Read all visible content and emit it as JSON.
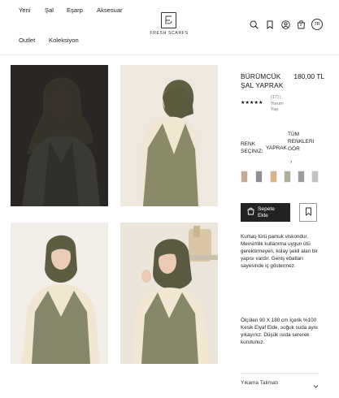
{
  "header": {
    "nav_row1": [
      "Yeni",
      "Şal",
      "Eşarp",
      "Aksesuar"
    ],
    "nav_row2": [
      "Outlet",
      "Koleksiyon"
    ],
    "logo_text": "FRESH SCARFS",
    "lang": "TR",
    "cart_count": "0",
    "icons": [
      "search-icon",
      "bookmark-icon",
      "user-icon",
      "bag-icon"
    ]
  },
  "product": {
    "title": "BÜRÜMCÜK ŞAL YAPRAK",
    "price": "180,00 TL",
    "stars": "★★★★★",
    "rating_text": "(17) | Yorum Yap",
    "color_label": "RENK SEÇINIZ:",
    "selected_color": "YAPRAK",
    "all_colors_label": "TÜM RENKLERI GÖR",
    "swatch_colors": [
      "#c9a99a",
      "#8f8e95",
      "#d6b58a",
      "#b0ad9a",
      "#9a9c9f",
      "#c4c3c0"
    ],
    "add_to_cart": "Sepete Ekle",
    "description_1": "Kumaş türü pamuk viskondur. Mevsimlik kullanıma uygun ütü gerektirmeyen, kolay şekil alan bir yapısı vardır. Geniş ebatları sayesinde iç göstermez.",
    "description_2": "Ölçüleri 90 X 180 cm İçerik %100 Kesik Elyaf Elde, soğuk suda aynı yıkayınız. Düşük ısıda sererek kurutunuz.",
    "wash_label": "Yıkama Talimatı"
  },
  "colors": {
    "scarf": "#5a5a40",
    "vest": "#8a8a6a",
    "shirt": "#f1e9d6",
    "skin": "#e9c9b2",
    "bg_photo": "#ebe3d6"
  }
}
